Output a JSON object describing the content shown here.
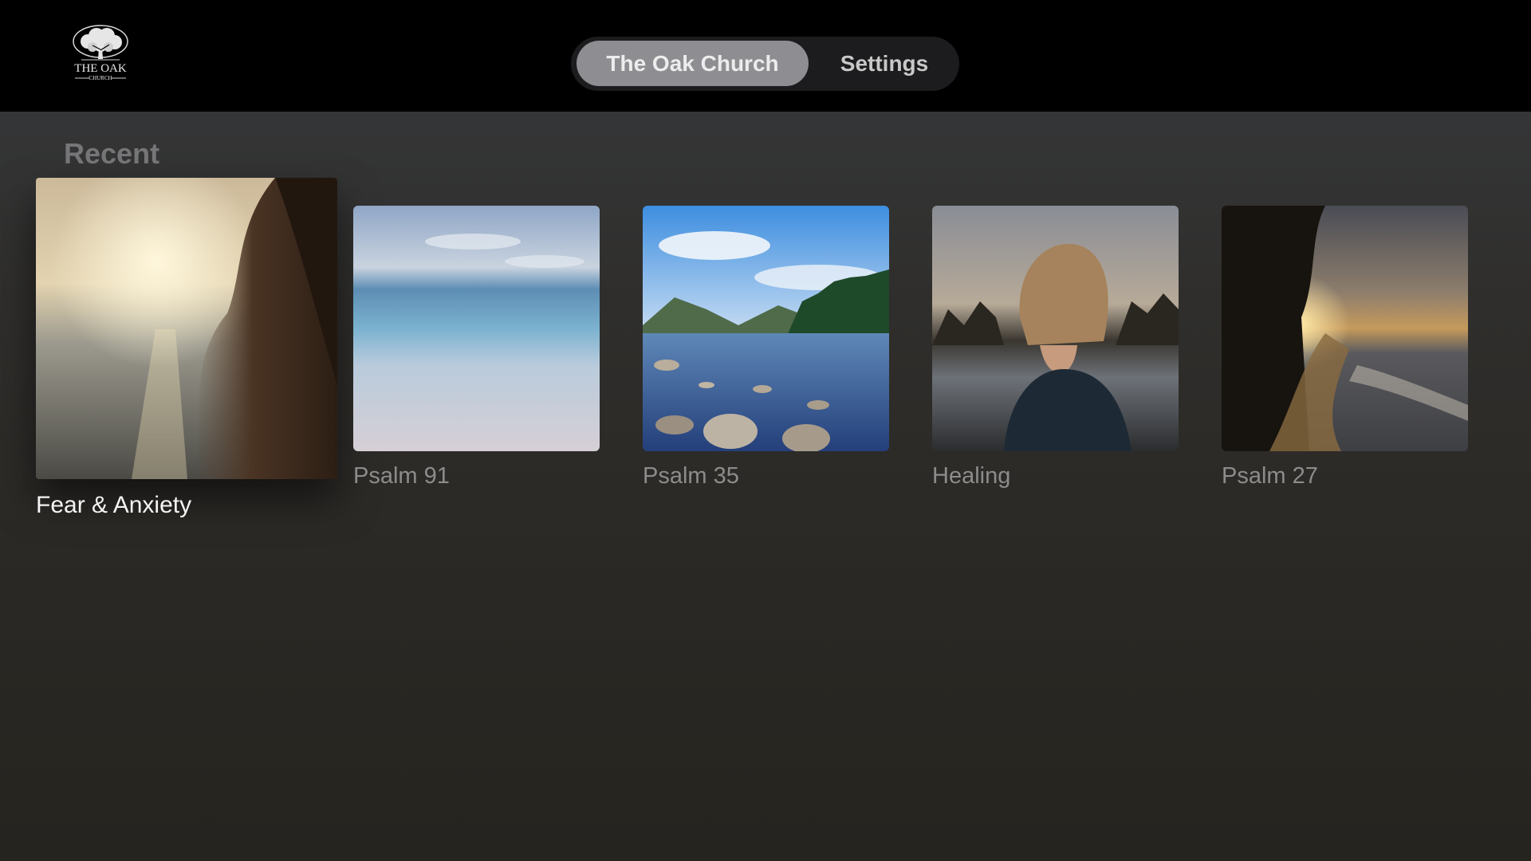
{
  "header": {
    "logo_icon": "oak-tree-logo-icon",
    "logo_text": "THE OAK",
    "logo_subtext": "CHURCH",
    "tabs": [
      {
        "label": "The Oak Church",
        "selected": true
      },
      {
        "label": "Settings",
        "selected": false
      }
    ]
  },
  "recent": {
    "title": "Recent",
    "items": [
      {
        "label": "Fear & Anxiety",
        "focused": true,
        "image": "woman-hair-sunset-sea"
      },
      {
        "label": "Psalm 91",
        "focused": false,
        "image": "calm-ocean-beach"
      },
      {
        "label": "Psalm 35",
        "focused": false,
        "image": "mountain-lake-rocks"
      },
      {
        "label": "Healing",
        "focused": false,
        "image": "girl-lake-sunset"
      },
      {
        "label": "Psalm 27",
        "focused": false,
        "image": "beach-sunset-trees"
      }
    ]
  },
  "colors": {
    "topbar": "#000000",
    "selected_tab": "#8e8e92",
    "focused_label": "#f4f4f4",
    "label": "#8c8c8c"
  }
}
